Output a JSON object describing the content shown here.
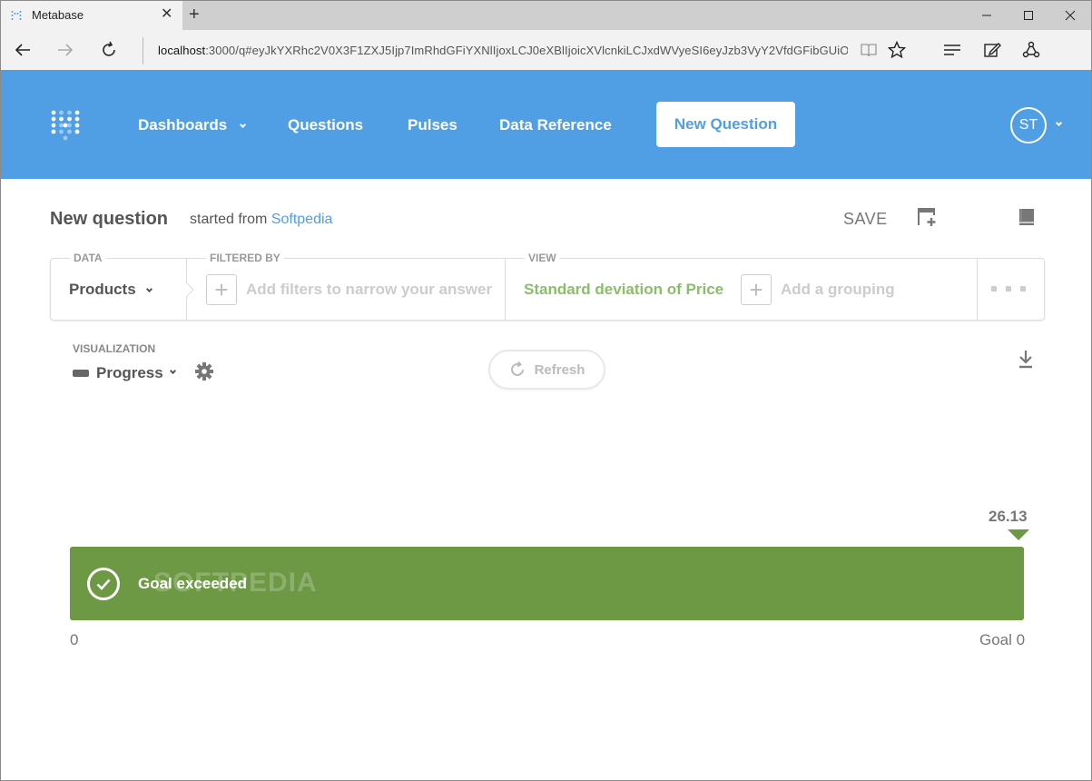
{
  "browser": {
    "tab_title": "Metabase",
    "url_host": "localhost",
    "url_rest": ":3000/q#eyJkYXRhc2V0X3F1ZXJ5Ijp7ImRhdGFiYXNlIjoxLCJ0eXBlIjoicXVlcnkiLCJxdWVyeSI6eyJzb3VyY2VfdGFibGUiOjMsImFn"
  },
  "header": {
    "nav": [
      "Dashboards",
      "Questions",
      "Pulses",
      "Data Reference"
    ],
    "new_question": "New Question",
    "avatar_initials": "ST",
    "brand_color": "#509ee3"
  },
  "question": {
    "title": "New question",
    "started_prefix": "started from",
    "started_source": "Softpedia",
    "save_label": "SAVE"
  },
  "query_builder": {
    "data_label": "DATA",
    "data_value": "Products",
    "filter_label": "FILTERED BY",
    "filter_placeholder": "Add filters to narrow your answer",
    "view_label": "VIEW",
    "view_value": "Standard deviation of Price",
    "grouping_placeholder": "Add a grouping"
  },
  "visualization": {
    "label": "VISUALIZATION",
    "type": "Progress",
    "refresh_label": "Refresh"
  },
  "progress": {
    "value_label": "26.13",
    "value": 26.13,
    "goal": 0,
    "fill_fraction": 1.0,
    "message": "Goal exceeded",
    "min_label": "0",
    "goal_label": "Goal 0",
    "color": "#6e9944"
  },
  "watermark": "SOFTPEDIA"
}
